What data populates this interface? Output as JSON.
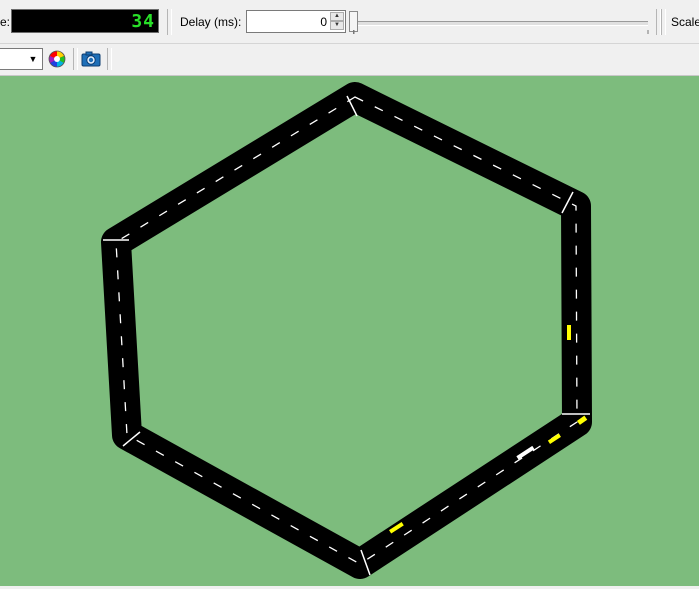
{
  "toolbar": {
    "time_label_fragment": "e:",
    "time_counter": "34",
    "delay_label": "Delay (ms):",
    "delay_value": "0",
    "scale_label": "Scale"
  },
  "view_toolbar": {
    "scheme_combo_value": "",
    "icons": [
      "color-wheel-icon",
      "camera-icon"
    ]
  },
  "simulation": {
    "background_color": "#7dbc7d",
    "road_color": "#000000",
    "lane_marking_color": "#ffffff",
    "vehicle_colors": [
      "#ffff00",
      "#ffffff"
    ]
  }
}
